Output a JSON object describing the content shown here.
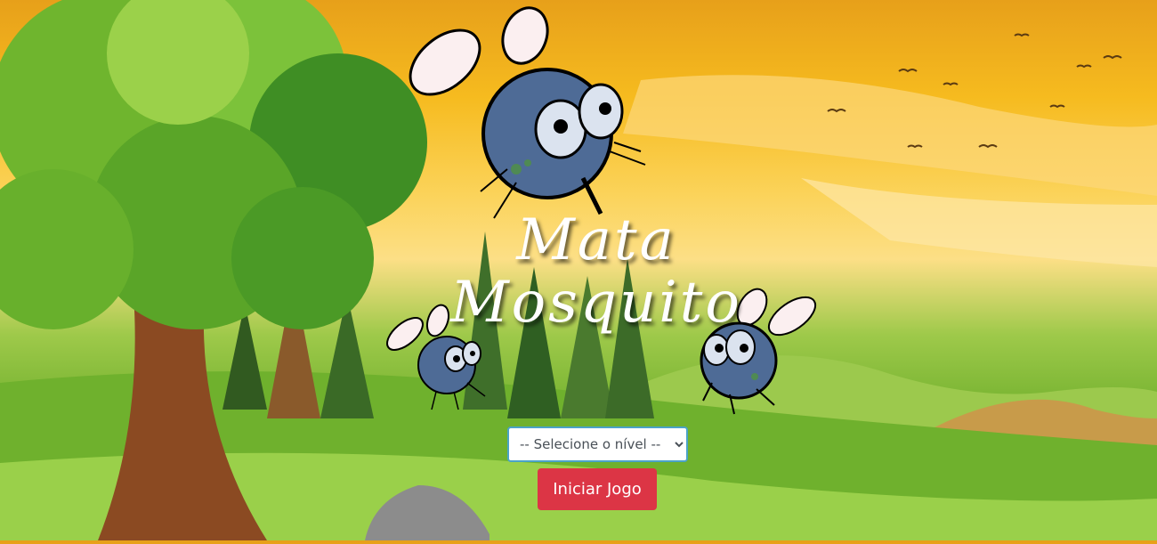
{
  "game": {
    "title": "Mata Mosquito",
    "level_select": {
      "selected": "-- Selecione o nível --",
      "options": [
        "-- Selecione o nível --"
      ]
    },
    "start_button_label": "Iniciar Jogo"
  },
  "colors": {
    "sky_top": "#e7a01a",
    "sky_mid": "#fbd35a",
    "grass": "#6faf2c",
    "button": "#dc3545",
    "mosquito_body": "#4e6b96"
  },
  "icons": {
    "mosquito": "mosquito-icon",
    "tree": "tree-icon",
    "bird": "bird-icon"
  }
}
